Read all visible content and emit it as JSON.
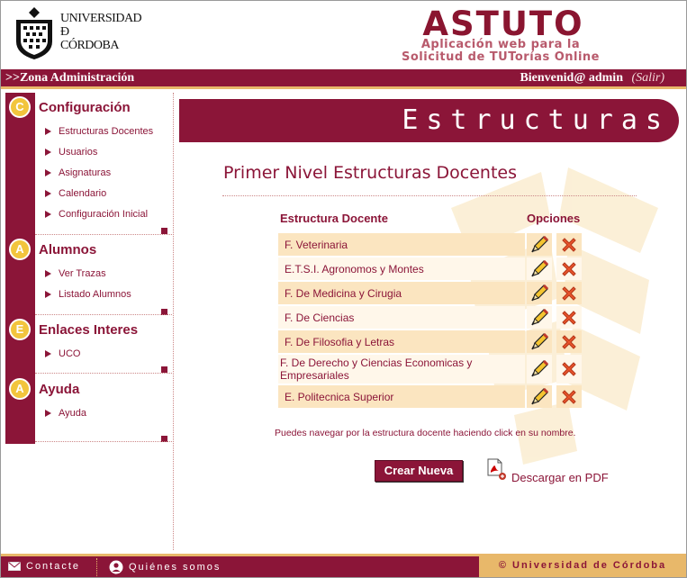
{
  "header": {
    "logo_lines": [
      "UNIVERSIDAD",
      "Ð",
      "CÓRDOBA"
    ],
    "app_title": "ASTUTO",
    "app_subtitle_1": "Aplicación web para la",
    "app_subtitle_2": "Solicitud de TUTorías Online"
  },
  "topbar": {
    "zone": ">>Zona Administración",
    "welcome": "Bienvenid@ admin",
    "logout": "(Salir)"
  },
  "sidebar": {
    "sections": [
      {
        "badge": "C",
        "title": "Configuración",
        "items": [
          "Estructuras Docentes",
          "Usuarios",
          "Asignaturas",
          "Calendario",
          "Configuración Inicial"
        ]
      },
      {
        "badge": "A",
        "title": "Alumnos",
        "items": [
          "Ver Trazas",
          "Listado Alumnos"
        ]
      },
      {
        "badge": "E",
        "title": "Enlaces Interes",
        "items": [
          "UCO"
        ]
      },
      {
        "badge": "A",
        "title": "Ayuda",
        "items": [
          "Ayuda"
        ]
      }
    ]
  },
  "main": {
    "banner": "Estructuras",
    "page_title": "Primer Nivel Estructuras Docentes",
    "col_structure": "Estructura Docente",
    "col_options": "Opciones",
    "rows": [
      "F. Veterinaria",
      "E.T.S.I. Agronomos y Montes",
      "F. De Medicina y Cirugia",
      "F. De Ciencias",
      "F. De Filosofia y Letras",
      "F. De Derecho y Ciencias Economicas y Empresariales",
      "E. Politecnica Superior"
    ],
    "hint": "Puedes navegar por la estructura docente haciendo click en su nombre.",
    "new_button": "Crear Nueva",
    "pdf_link": "Descargar en PDF"
  },
  "footer": {
    "contact": "Contacte",
    "about": "Quiénes somos",
    "copyright": "© Universidad de Córdoba"
  },
  "colors": {
    "brand": "#8b1538",
    "accent": "#e8b86a",
    "badge": "#f2c53d",
    "row": "#fbe5c0",
    "row_alt": "#fff7ea"
  }
}
